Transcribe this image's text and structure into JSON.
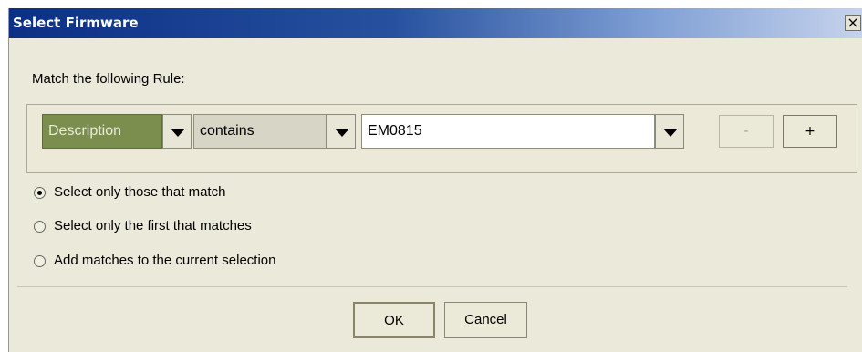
{
  "window": {
    "title": "Select Firmware",
    "close_label": "×"
  },
  "rule": {
    "heading": "Match the following Rule:",
    "field_value": "Description",
    "operator_value": "contains",
    "text_value": "EM0815",
    "remove_label": "-",
    "add_label": "+"
  },
  "options": [
    {
      "label": "Select only those that match",
      "selected": true
    },
    {
      "label": "Select only the first that matches",
      "selected": false
    },
    {
      "label": "Add matches to the current selection",
      "selected": false
    }
  ],
  "buttons": {
    "ok_label": "OK",
    "cancel_label": "Cancel"
  },
  "colors": {
    "title_gradient_start": "#0b2f85",
    "field_accent": "#7b8e4d",
    "dialog_bg": "#ebe9d9"
  }
}
